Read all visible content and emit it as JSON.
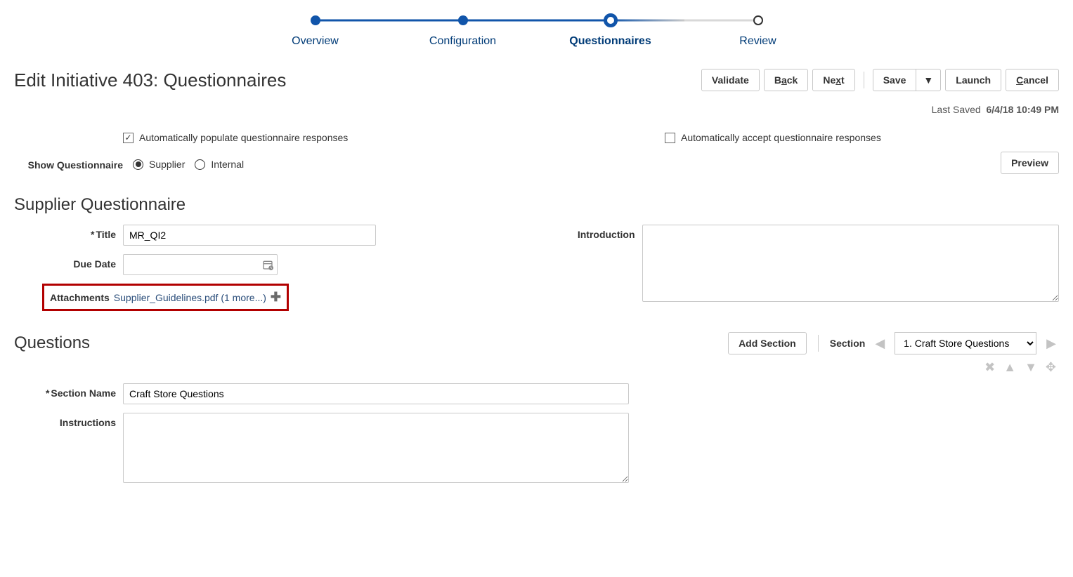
{
  "train": {
    "steps": [
      {
        "label": "Overview",
        "state": "done"
      },
      {
        "label": "Configuration",
        "state": "done"
      },
      {
        "label": "Questionnaires",
        "state": "current"
      },
      {
        "label": "Review",
        "state": "future"
      }
    ]
  },
  "page_title": "Edit Initiative 403: Questionnaires",
  "toolbar": {
    "validate": "Validate",
    "back_prefix": "B",
    "back_ul": "a",
    "back_suffix": "ck",
    "next_prefix": "Ne",
    "next_ul": "x",
    "next_suffix": "t",
    "save": "Save",
    "launch": "Launch",
    "cancel_ul": "C",
    "cancel_suffix": "ancel"
  },
  "last_saved_label": "Last Saved",
  "last_saved_value": "6/4/18 10:49 PM",
  "options": {
    "auto_populate": {
      "label": "Automatically populate questionnaire responses",
      "checked": true
    },
    "auto_accept": {
      "label": "Automatically accept questionnaire responses",
      "checked": false
    }
  },
  "show_q": {
    "label": "Show Questionnaire",
    "supplier": "Supplier",
    "internal": "Internal",
    "selected": "supplier"
  },
  "preview_btn": "Preview",
  "supplier_q_title": "Supplier Questionnaire",
  "form": {
    "title_label": "Title",
    "title_value": "MR_QI2",
    "due_date_label": "Due Date",
    "due_date_value": "",
    "attachments_label": "Attachments",
    "attachments_link": "Supplier_Guidelines.pdf (1 more...)",
    "introduction_label": "Introduction",
    "introduction_value": ""
  },
  "questions": {
    "heading": "Questions",
    "add_section": "Add Section",
    "section_label": "Section",
    "section_options": [
      "1. Craft Store Questions"
    ],
    "section_selected": "1. Craft Store Questions",
    "section_name_label": "Section Name",
    "section_name_value": "Craft Store Questions",
    "instructions_label": "Instructions",
    "instructions_value": ""
  }
}
